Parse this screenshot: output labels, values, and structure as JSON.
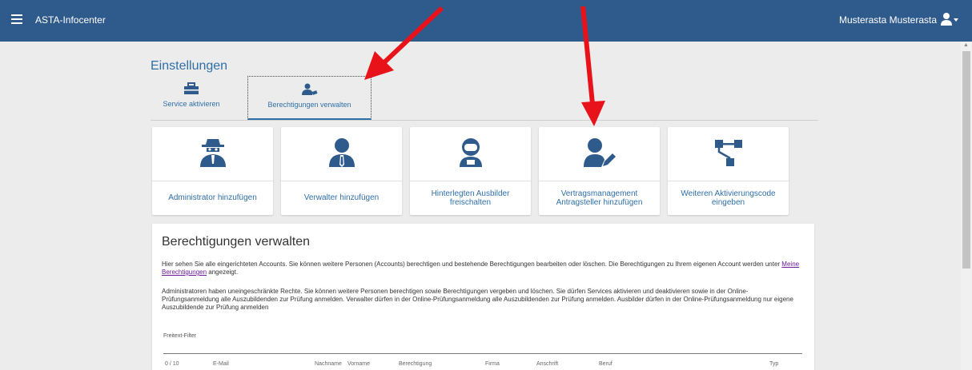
{
  "topbar": {
    "app_title": "ASTA-Infocenter",
    "user_name": "Musterasta Musterasta"
  },
  "settings": {
    "title": "Einstellungen",
    "tabs": [
      {
        "label": "Service aktivieren",
        "icon": "toolbox-icon"
      },
      {
        "label": "Berechtigungen verwalten",
        "icon": "user-key-icon",
        "active": true
      }
    ]
  },
  "tiles": [
    {
      "label": "Administrator hinzufügen",
      "icon": "spy-agent-icon"
    },
    {
      "label": "Verwalter hinzufügen",
      "icon": "user-tie-icon"
    },
    {
      "label": "Hinterlegten Ausbilder freischalten",
      "icon": "astronaut-icon"
    },
    {
      "label": "Vertragsmanagement Antragsteller hinzufügen",
      "icon": "user-edit-icon"
    },
    {
      "label": "Weiteren Aktivierungscode eingeben",
      "icon": "sitemap-icon"
    }
  ],
  "panel": {
    "title": "Berechtigungen verwalten",
    "para1_text": "Hier sehen Sie alle eingerichteten Accounts. Sie können weitere Personen (Accounts) berechtigen und bestehende Berechtigungen bearbeiten oder löschen. Die Berechtigungen zu Ihrem eigenen Account werden unter",
    "para1_link": "Meine Berechtigungen",
    "para1_end": "angezeigt.",
    "para2": "Administratoren haben uneingeschränkte Rechte. Sie können weitere Personen berechtigen sowie Berechtigungen vergeben und löschen. Sie dürfen Services aktivieren und deaktivieren sowie in der Online-Prüfungsanmeldung alle Auszubildenden zur Prüfung anmelden. Verwalter dürfen in der Online-Prüfungsanmeldung alle Auszubildenden zur Prüfung anmelden. Ausbilder dürfen in der Online-Prüfungsanmeldung nur eigene Auszubildende zur Prüfung anmelden",
    "filter_label": "Freitext-Filter",
    "table": {
      "count": "0 / 10",
      "headers": [
        "E-Mail",
        "Nachname",
        "Vorname",
        "Berechtigung",
        "Firma",
        "Anschrift",
        "Beruf",
        "Typ"
      ]
    }
  },
  "colors": {
    "header_bg": "#2f5b8c",
    "accent": "#2f6fa8",
    "annotation_arrow": "#e8121a"
  }
}
